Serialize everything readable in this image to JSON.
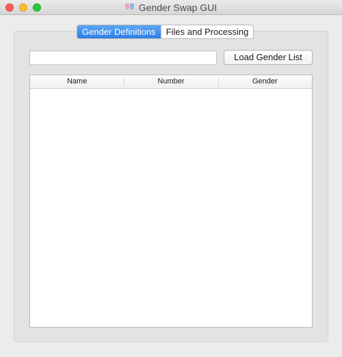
{
  "window": {
    "title": "Gender Swap GUI"
  },
  "tabs": [
    {
      "label": "Gender Definitions",
      "active": true
    },
    {
      "label": "Files and Processing",
      "active": false
    }
  ],
  "gender_definitions": {
    "path_input": {
      "value": "",
      "placeholder": ""
    },
    "load_button_label": "Load Gender List",
    "table": {
      "columns": [
        "Name",
        "Number",
        "Gender"
      ],
      "rows": []
    }
  },
  "colors": {
    "active_tab": "#2f7fe8",
    "close": "#fc5f57",
    "minimize": "#fdbc2e",
    "zoom": "#28c840"
  }
}
